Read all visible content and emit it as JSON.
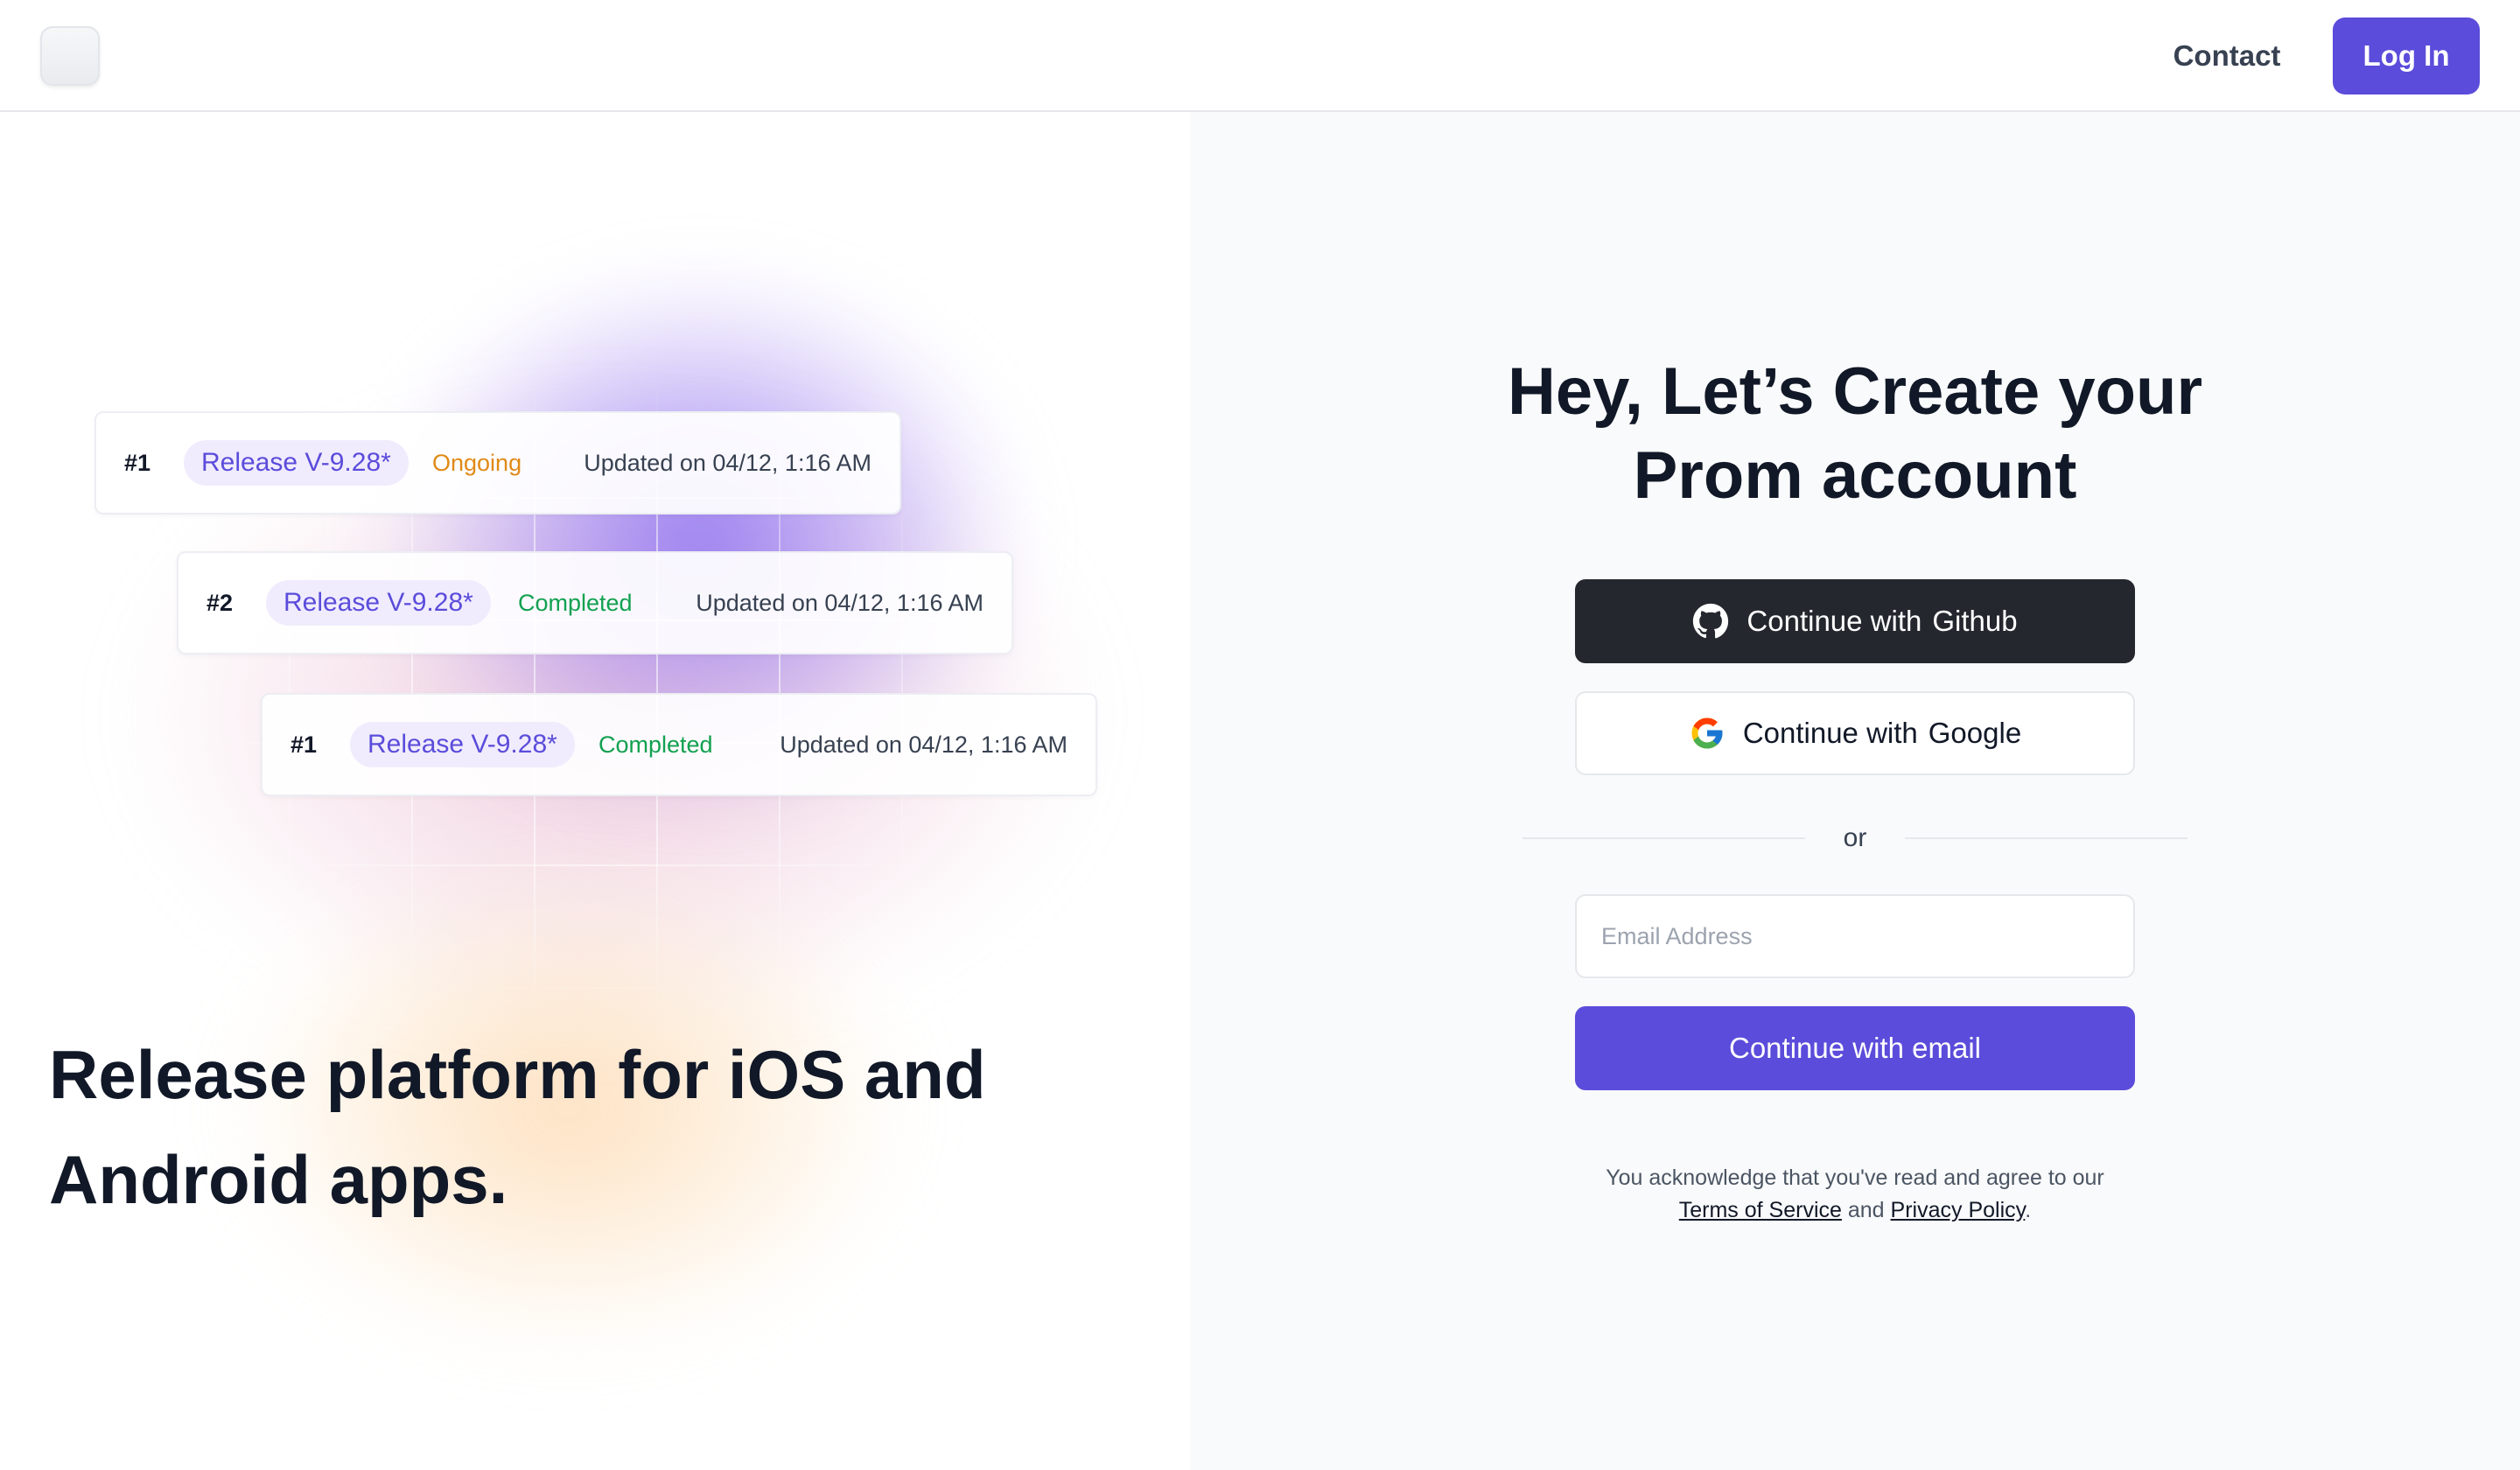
{
  "header": {
    "logo": "app-logo",
    "contact_label": "Contact",
    "login_label": "Log In"
  },
  "hero": {
    "cards": [
      {
        "number": "#1",
        "tag": "Release V-9.28*",
        "status": "Ongoing",
        "updated": "Updated on 04/12, 1:16 AM"
      },
      {
        "number": "#2",
        "tag": "Release V-9.28*",
        "status": "Completed",
        "updated": "Updated on 04/12, 1:16 AM"
      },
      {
        "number": "#1",
        "tag": "Release V-9.28*",
        "status": "Completed",
        "updated": "Updated on 04/12, 1:16 AM"
      }
    ],
    "headline_line1": "Release platform for iOS and",
    "headline_line2": "Android apps."
  },
  "auth": {
    "title_line1": "Hey, Let’s Create your",
    "title_line2": "Prom account",
    "continue_with": "Continue with",
    "github_label": "Github",
    "google_label": "Google",
    "divider_label": "or",
    "email_placeholder": "Email Address",
    "email_value": "",
    "email_button_label": "Continue with email",
    "legal_text": "You acknowledge that you've read and agree to our",
    "terms_label": "Terms of Service",
    "and_label": "and",
    "privacy_label": "Privacy Policy",
    "period": "."
  },
  "colors": {
    "accent": "#5b4cdb",
    "github_button": "#24272e",
    "status_ongoing": "#e08a16",
    "status_completed": "#12a150",
    "right_panel_bg": "#f9fafb"
  }
}
